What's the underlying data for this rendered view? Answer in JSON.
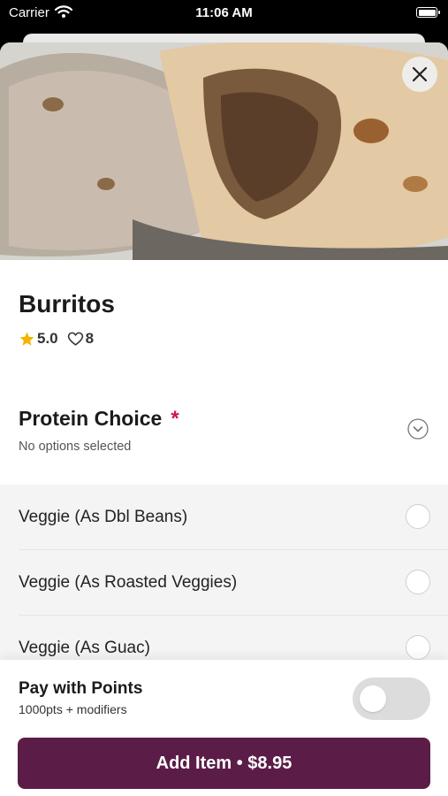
{
  "status_bar": {
    "carrier": "Carrier",
    "time": "11:06 AM"
  },
  "item": {
    "title": "Burritos",
    "rating": "5.0",
    "likes": "8"
  },
  "colors": {
    "accent": "#5b1d47",
    "required": "#c8174e",
    "star": "#f4b400"
  },
  "icons": {
    "close": "close-icon",
    "star": "star-icon",
    "heart": "heart-outline-icon",
    "chevron": "chevron-down-circle-icon",
    "wifi": "wifi-icon",
    "battery": "battery-icon"
  },
  "protein_section": {
    "title": "Protein Choice",
    "required_mark": "*",
    "subtitle": "No options selected",
    "options": [
      {
        "label": "Veggie (As Dbl Beans)",
        "selected": false
      },
      {
        "label": "Veggie (As Roasted Veggies)",
        "selected": false
      },
      {
        "label": "Veggie (As Guac)",
        "selected": false
      }
    ]
  },
  "points": {
    "title": "Pay with Points",
    "subtitle": "1000pts + modifiers",
    "enabled": false
  },
  "add_button": {
    "label": "Add Item • $8.95"
  }
}
